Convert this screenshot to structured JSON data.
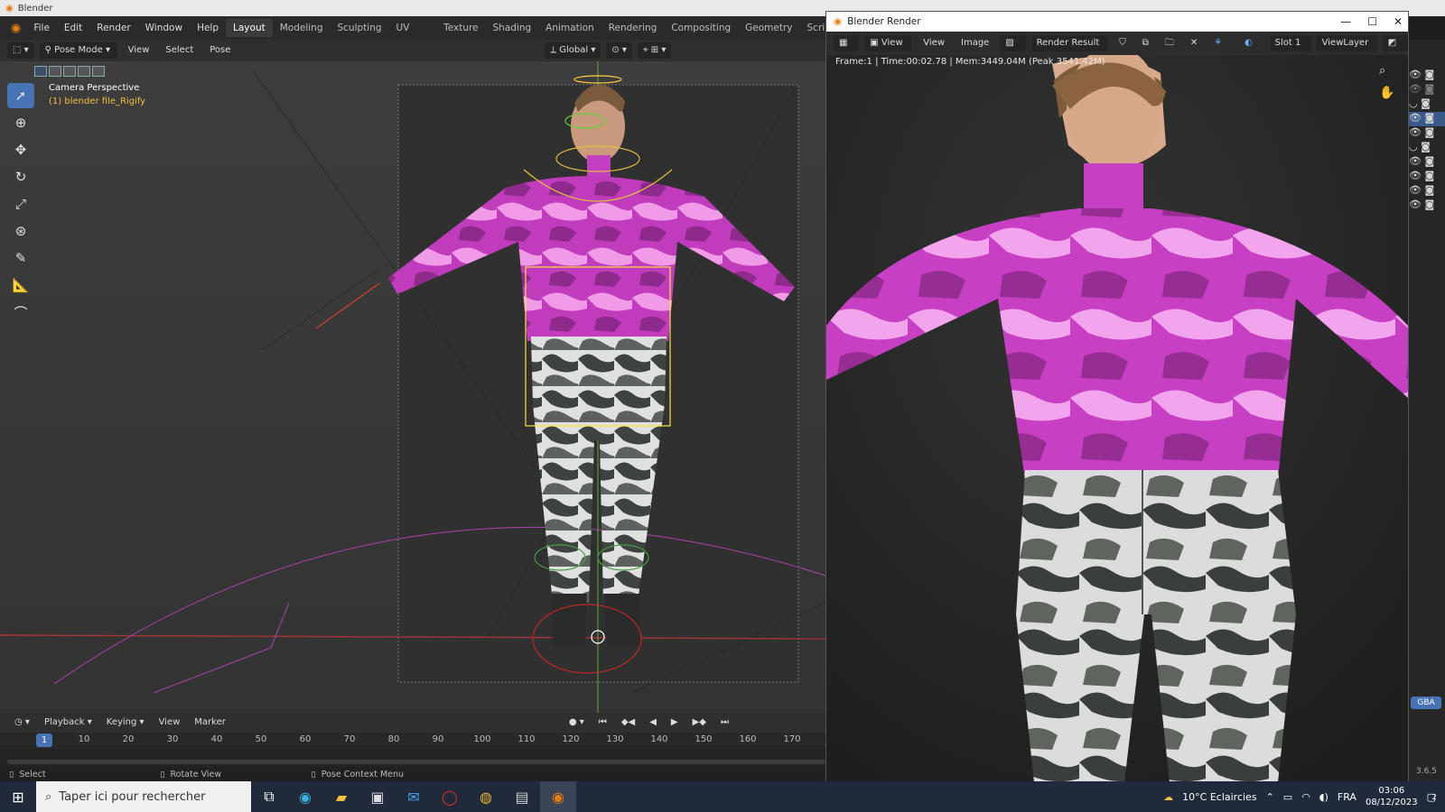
{
  "app": {
    "title": "Blender"
  },
  "menubar": {
    "items": [
      "File",
      "Edit",
      "Render",
      "Window",
      "Help"
    ],
    "workspaces": [
      "Layout",
      "Modeling",
      "Sculpting",
      "UV Editing",
      "Texture Paint",
      "Shading",
      "Animation",
      "Rendering",
      "Compositing",
      "Geometry Nodes",
      "Scripting"
    ],
    "active_workspace": "Layout",
    "add_icon": "plus-icon"
  },
  "header3d": {
    "mode": "Pose Mode",
    "menus": [
      "View",
      "Select",
      "Pose"
    ],
    "orientation": "Global"
  },
  "viewport": {
    "camera_label": "Camera Perspective",
    "object_label": "(1) blender file_Rigify"
  },
  "timeline": {
    "menus": [
      "Playback",
      "Keying",
      "View",
      "Marker"
    ],
    "current_frame": "1",
    "ticks": [
      "10",
      "20",
      "30",
      "40",
      "50",
      "60",
      "70",
      "80",
      "90",
      "100",
      "110",
      "120",
      "130",
      "140",
      "150",
      "160",
      "170"
    ]
  },
  "statusbar": {
    "select": "Select",
    "rotate": "Rotate View",
    "context": "Pose Context Menu"
  },
  "render_window": {
    "title": "Blender Render",
    "menus": [
      "View",
      "View",
      "Image"
    ],
    "image_name": "Render Result",
    "slot": "Slot 1",
    "view_layer": "ViewLayer",
    "stats": "Frame:1 | Time:00:02.78 | Mem:3449.04M (Peak 3541.42M)",
    "minimize": "—",
    "maximize": "☐",
    "close": "✕"
  },
  "right_sidebar": {
    "version": "3.6.5",
    "rgba_label": "GBA"
  },
  "taskbar": {
    "search_placeholder": "Taper ici pour rechercher",
    "weather": "10°C  Eclaircies",
    "lang": "FRA",
    "time": "03:06",
    "date": "08/12/2023",
    "notif_count": "2"
  },
  "colors": {
    "accent": "#4772b3",
    "viewport_bg": "#3a3a3a",
    "shirt": "#c23fbf"
  }
}
